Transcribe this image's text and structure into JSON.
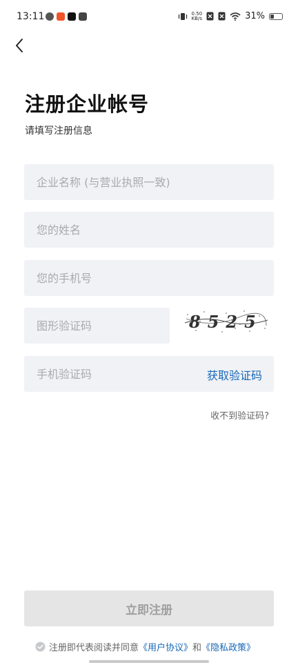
{
  "status_bar": {
    "time": "13:11",
    "net_speed_value": "0.50",
    "net_speed_unit": "KB/s",
    "battery": "31%",
    "battery_level": 0.31
  },
  "header": {
    "title": "注册企业帐号",
    "subtitle": "请填写注册信息"
  },
  "form": {
    "company_placeholder": "企业名称 (与营业执照一致)",
    "name_placeholder": "您的姓名",
    "phone_placeholder": "您的手机号",
    "image_code_placeholder": "图形验证码",
    "sms_code_placeholder": "手机验证码",
    "get_code_label": "获取验证码",
    "no_code_label": "收不到验证码?",
    "captcha_text": "8525"
  },
  "submit_label": "立即注册",
  "agreement": {
    "prefix": "注册即代表阅读并同意",
    "user_agreement": "《用户协议》",
    "and": "和",
    "privacy_policy": "《隐私政策》"
  },
  "colors": {
    "link": "#1768b8",
    "field_bg": "#f1f2f5",
    "button_disabled": "#e5e5e5"
  }
}
